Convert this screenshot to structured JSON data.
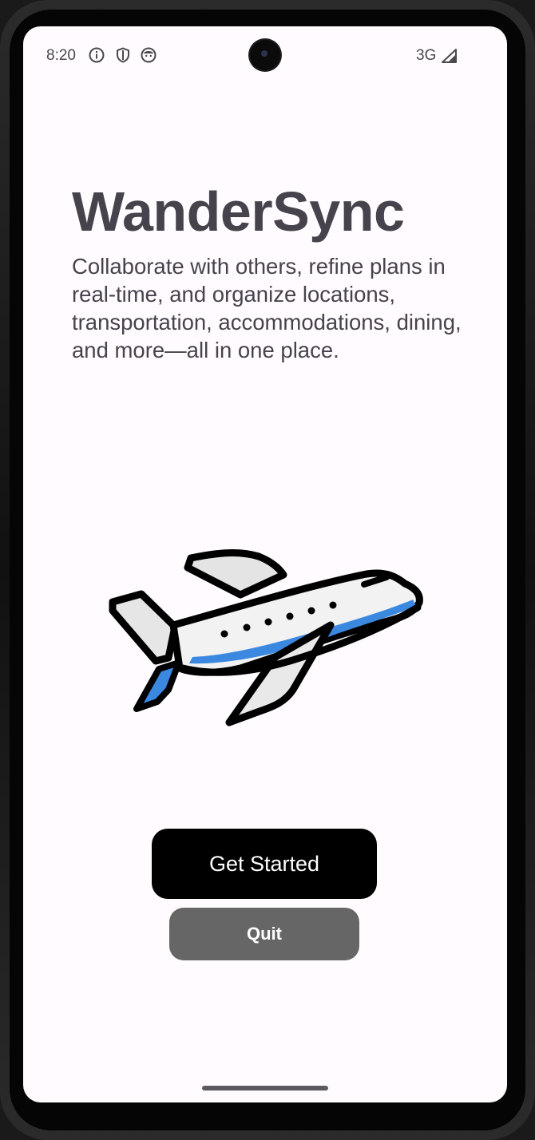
{
  "status_bar": {
    "time": "8:20",
    "icons": [
      "info-icon",
      "shield-icon",
      "face-icon"
    ],
    "network": "3G",
    "signal_icon": "signal-icon"
  },
  "app": {
    "title": "WanderSync",
    "description": "Collaborate with others, refine plans in real-time, and organize locations, transportation, accommodations, dining, and more—all in one place.",
    "illustration_icon": "airplane-icon"
  },
  "actions": {
    "get_started_label": "Get Started",
    "quit_label": "Quit"
  },
  "colors": {
    "background": "#fffbfe",
    "text": "#46434c",
    "primary_button": "#000000",
    "secondary_button": "#666666",
    "plane_accent": "#3b88e0"
  }
}
